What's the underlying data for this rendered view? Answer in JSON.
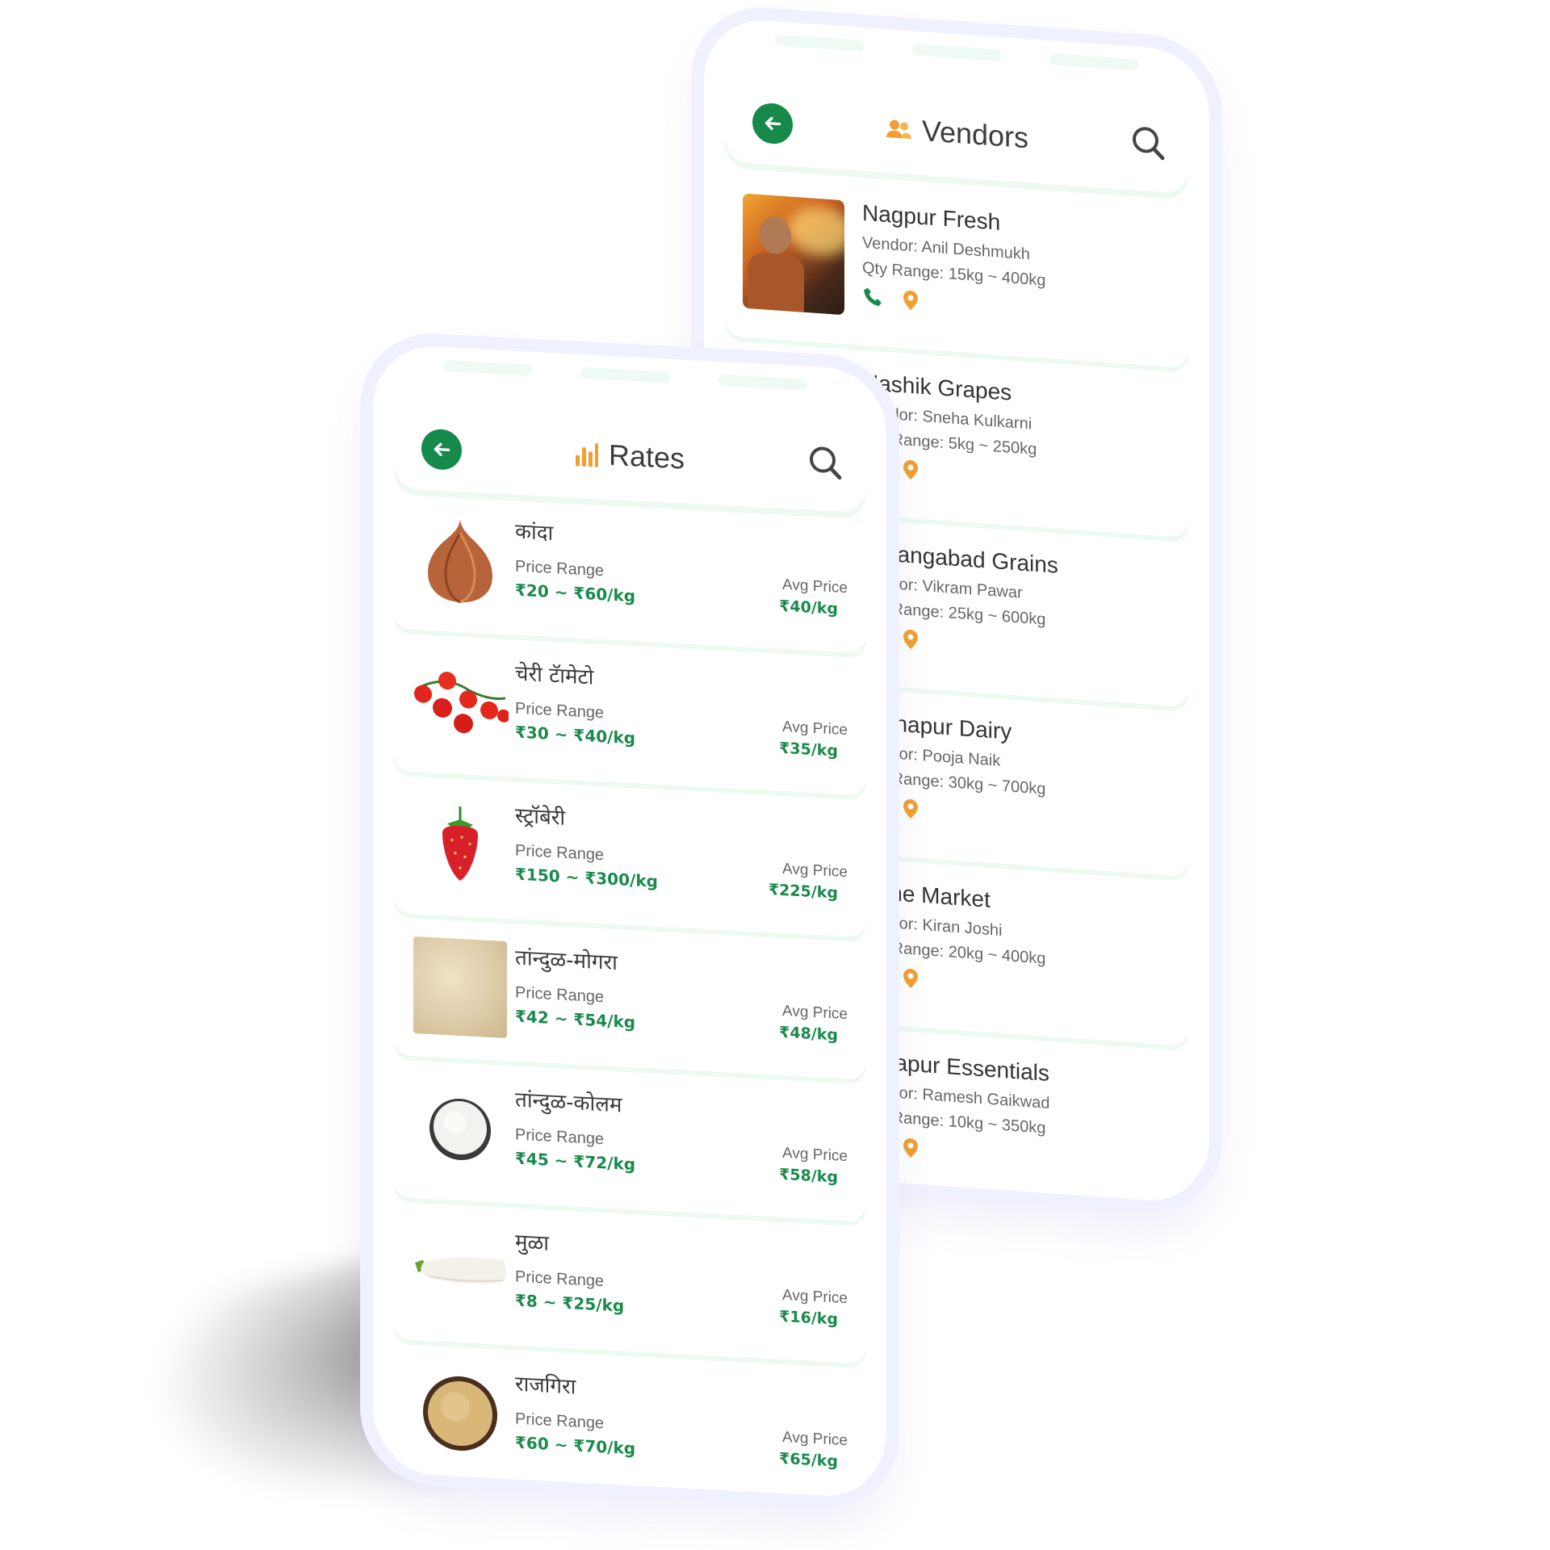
{
  "vendors_screen": {
    "title": "Vendors",
    "icons": {
      "back": "arrow-left-icon",
      "title": "people-icon",
      "search": "search-icon",
      "call": "phone-icon",
      "location": "map-pin-icon"
    },
    "vendors": [
      {
        "name": "Nagpur Fresh",
        "vendor": "Vendor: Anil Deshmukh",
        "qty": "Qty Range: 15kg ~ 400kg"
      },
      {
        "name": "Nashik Grapes",
        "vendor": "Vendor: Sneha Kulkarni",
        "qty": "Qty Range: 5kg ~ 250kg"
      },
      {
        "name": "Aurangabad Grains",
        "vendor": "Vendor: Vikram Pawar",
        "qty": "Qty Range: 25kg ~ 600kg"
      },
      {
        "name": "Kolhapur Dairy",
        "vendor": "Vendor: Pooja Naik",
        "qty": "Qty Range: 30kg ~ 700kg"
      },
      {
        "name": "Pune Market",
        "vendor": "Vendor: Kiran Joshi",
        "qty": "Qty Range: 20kg ~ 400kg"
      },
      {
        "name": "Solapur Essentials",
        "vendor": "Vendor: Ramesh Gaikwad",
        "qty": "Qty Range: 10kg ~ 350kg"
      }
    ]
  },
  "rates_screen": {
    "title": "Rates",
    "price_range_label": "Price Range",
    "avg_price_label": "Avg Price",
    "icons": {
      "back": "arrow-left-icon",
      "title": "bar-chart-icon",
      "search": "search-icon"
    },
    "items": [
      {
        "name": "कांदा",
        "range": "₹20 ~ ₹60/kg",
        "avg": "₹40/kg",
        "icon": "onion-icon"
      },
      {
        "name": "चेरी टॅामेटो",
        "range": "₹30 ~ ₹40/kg",
        "avg": "₹35/kg",
        "icon": "cherry-tomato-icon"
      },
      {
        "name": "स्ट्रॉबेरी",
        "range": "₹150 ~ ₹300/kg",
        "avg": "₹225/kg",
        "icon": "strawberry-icon"
      },
      {
        "name": "तांन्दुळ-मोगरा",
        "range": "₹42 ~ ₹54/kg",
        "avg": "₹48/kg",
        "icon": "rice-heap-icon"
      },
      {
        "name": "तांन्दुळ-कोलम",
        "range": "₹45 ~ ₹72/kg",
        "avg": "₹58/kg",
        "icon": "rice-bowl-icon"
      },
      {
        "name": "मुळा",
        "range": "₹8 ~ ₹25/kg",
        "avg": "₹16/kg",
        "icon": "radish-icon"
      },
      {
        "name": "राजगिरा",
        "range": "₹60 ~ ₹70/kg",
        "avg": "₹65/kg",
        "icon": "amaranth-bowl-icon"
      }
    ]
  },
  "colors": {
    "primary_green": "#168a4a",
    "price_green": "#1a8a4c",
    "accent_orange": "#f0a030",
    "frame": "#f0f1ff"
  }
}
